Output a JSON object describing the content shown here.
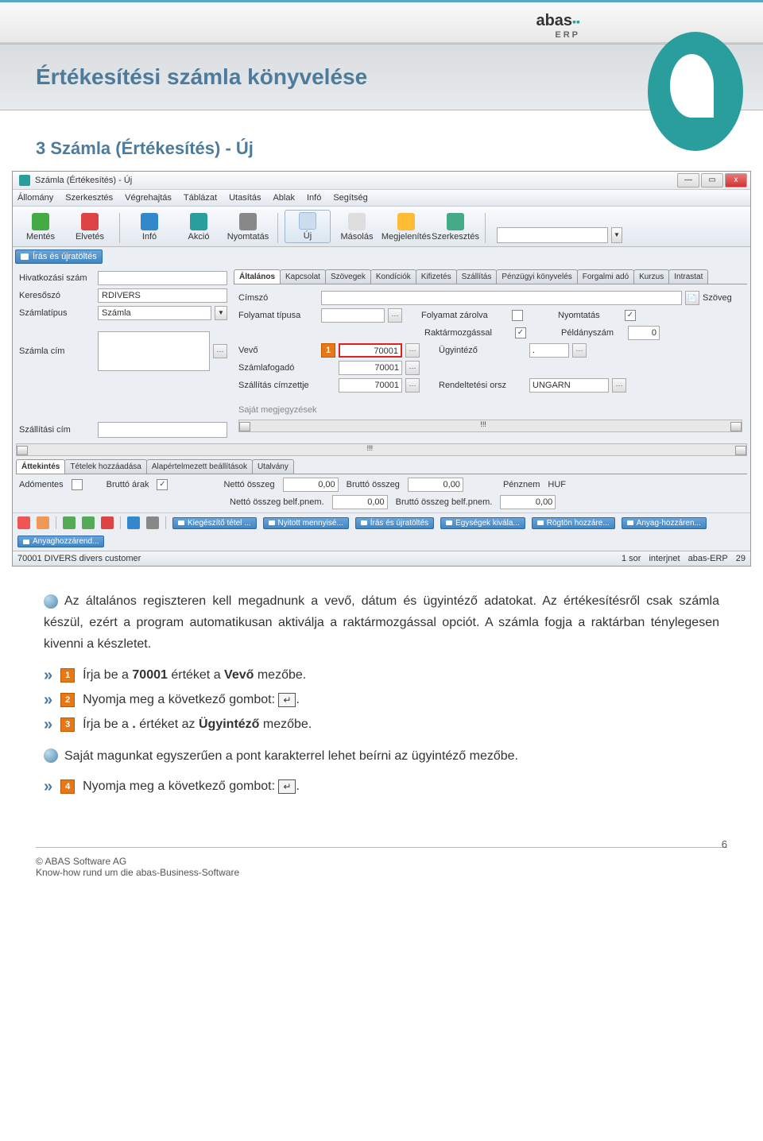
{
  "header": {
    "logo_text": "abas",
    "logo_sub": "ERP"
  },
  "slide": {
    "title": "Értékesítési számla könyvelése",
    "sub": "3 Számla (Értékesítés) - Új"
  },
  "win": {
    "title": "Számla (Értékesítés) - Új",
    "min": "—",
    "max": "▭",
    "close": "x"
  },
  "menu": [
    "Állomány",
    "Szerkesztés",
    "Végrehajtás",
    "Táblázat",
    "Utasítás",
    "Ablak",
    "Infó",
    "Segítség"
  ],
  "toolbar": {
    "save": "Mentés",
    "discard": "Elvetés",
    "info": "Infó",
    "action": "Akció",
    "print": "Nyomtatás",
    "new": "Új",
    "copy": "Másolás",
    "show": "Megjelenítés",
    "edit": "Szerkesztés"
  },
  "blue_top": "Írás és újratöltés",
  "left": {
    "ref": "Hivatkozási szám",
    "search": "Keresőszó",
    "search_val": "RDIVERS",
    "type": "Számlatípus",
    "type_val": "Számla",
    "addr": "Számla cím",
    "ship": "Szállítási cím"
  },
  "tabs": [
    "Általános",
    "Kapcsolat",
    "Szövegek",
    "Kondíciók",
    "Kifizetés",
    "Szállítás",
    "Pénzügyi könyvelés",
    "Forgalmi adó",
    "Kurzus",
    "Intrastat"
  ],
  "panel": {
    "cimszo": "Címszó",
    "folyamat": "Folyamat típusa",
    "vevo": "Vevő",
    "vevo_val": "70001",
    "szamlafogado": "Számlafogadó",
    "szf_val": "70001",
    "szallcim": "Szállítás címzettje",
    "sc_val": "70001",
    "folyzar": "Folyamat zárolva",
    "raktarm": "Raktármozgással",
    "raktarm_chk": "✓",
    "ugy": "Ügyintéző",
    "ugy_val": ".",
    "rend": "Rendeltetési orsz",
    "rend_val": "UNGARN",
    "nyom": "Nyomtatás",
    "nyom_chk": "✓",
    "peld": "Példányszám",
    "peld_val": "0",
    "szoveg": "Szöveg",
    "sajat": "Saját megjegyzések",
    "sep": "!!!"
  },
  "tabs2": [
    "Áttekintés",
    "Tételek hozzáadása",
    "Alapértelmezett beállítások",
    "Utalvány"
  ],
  "summary": {
    "ado": "Adómentes",
    "brutto_arak": "Bruttó árak",
    "brutto_arak_chk": "✓",
    "netto": "Nettó összeg",
    "netto_val": "0,00",
    "brutto": "Bruttó összeg",
    "brutto_val": "0,00",
    "netto_belf": "Nettó összeg belf.pnem.",
    "netto_belf_val": "0,00",
    "brutto_belf": "Bruttó összeg belf.pnem.",
    "brutto_belf_val": "0,00",
    "penznem": "Pénznem",
    "penznem_val": "HUF"
  },
  "actions": [
    "Kiegészítő tétel ...",
    "Nyitott mennyisé...",
    "Írás és újratöltés",
    "Egységek kivála...",
    "Rögtön hozzáre...",
    "Anyag-hozzáren...",
    "Anyaghozzárend..."
  ],
  "status": {
    "left": "70001 DIVERS   divers customer",
    "rows": "1 sor",
    "net": "interjnet",
    "app": "abas-ERP",
    "num": "29"
  },
  "body": {
    "p1": "Az általános regiszteren kell megadnunk a vevő, dátum és ügyintéző adatokat. Az értékesítésről csak számla készül, ezért a program automatikusan aktiválja a raktármozgással opciót. A számla fogja a raktárban ténylegesen kivenni a készletet.",
    "s1a": "Írja be a ",
    "s1b": "70001",
    "s1c": " értéket a ",
    "s1d": "Vevő",
    "s1e": " mezőbe.",
    "s2": "Nyomja meg a következő gombot: ",
    "s3a": "Írja be a ",
    "s3b": ".",
    "s3c": " értéket az ",
    "s3d": "Ügyintéző",
    "s3e": " mezőbe.",
    "p2": "Saját magunkat egyszerűen a pont karakterrel lehet beírni az ügyintéző mezőbe.",
    "s4": "Nyomja meg a következő gombot: ",
    "enter": "↵"
  },
  "footer": {
    "c": "© ABAS Software AG",
    "t": "Know-how rund um die abas-Business-Software",
    "page": "6"
  },
  "markers": {
    "m1": "1",
    "m2": "2",
    "m3": "3",
    "m4": "4"
  }
}
